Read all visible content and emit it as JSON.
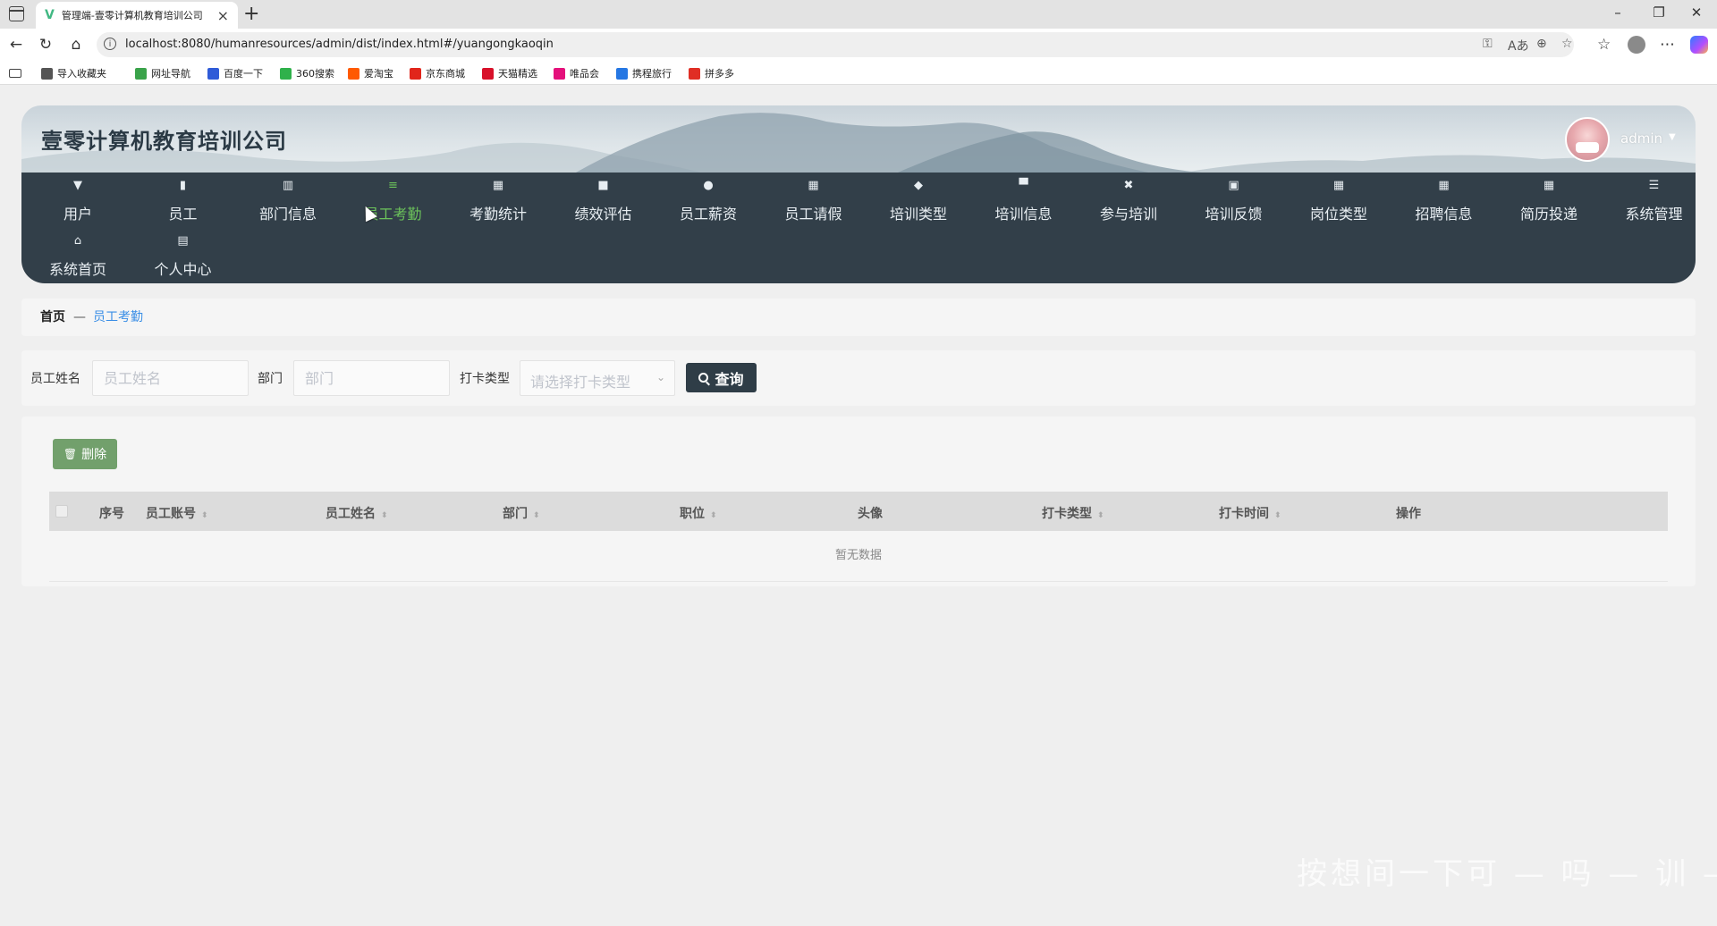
{
  "browser": {
    "tab_title": "管理端-壹零计算机教育培训公司",
    "url": "localhost:8080/humanresources/admin/dist/index.html#/yuangongkaoqin",
    "bookmarks": [
      {
        "label": "导入收藏夹",
        "icon": "import-icon",
        "color": "#555555"
      },
      {
        "label": "网址导航",
        "icon": "nav-leaf-icon",
        "color": "#3aa34a"
      },
      {
        "label": "百度一下",
        "icon": "baidu-paw-icon",
        "color": "#2f5bd8"
      },
      {
        "label": "360搜索",
        "icon": "360-ring-icon",
        "color": "#2fb14b"
      },
      {
        "label": "爱淘宝",
        "icon": "taobao-icon",
        "color": "#ff5a00"
      },
      {
        "label": "京东商城",
        "icon": "jd-icon",
        "color": "#e1251b"
      },
      {
        "label": "天猫精选",
        "icon": "tmall-icon",
        "color": "#d8112a"
      },
      {
        "label": "唯品会",
        "icon": "vip-icon",
        "color": "#e4107b"
      },
      {
        "label": "携程旅行",
        "icon": "ctrip-icon",
        "color": "#2577e3"
      },
      {
        "label": "拼多多",
        "icon": "pdd-icon",
        "color": "#e02e24"
      }
    ]
  },
  "header": {
    "site_title": "壹零计算机教育培训公司",
    "user_name": "admin"
  },
  "nav": {
    "active_index": 3,
    "items": [
      {
        "label": "用户",
        "icon": "▼"
      },
      {
        "label": "员工",
        "icon": "▮"
      },
      {
        "label": "部门信息",
        "icon": "▥"
      },
      {
        "label": "员工考勤",
        "icon": "≡"
      },
      {
        "label": "考勤统计",
        "icon": "▦"
      },
      {
        "label": "绩效评估",
        "icon": "■"
      },
      {
        "label": "员工薪资",
        "icon": "●"
      },
      {
        "label": "员工请假",
        "icon": "▦"
      },
      {
        "label": "培训类型",
        "icon": "◆"
      },
      {
        "label": "培训信息",
        "icon": "▀"
      },
      {
        "label": "参与培训",
        "icon": "✖"
      },
      {
        "label": "培训反馈",
        "icon": "▣"
      },
      {
        "label": "岗位类型",
        "icon": "▦"
      },
      {
        "label": "招聘信息",
        "icon": "▦"
      },
      {
        "label": "简历投递",
        "icon": "▦"
      },
      {
        "label": "系统管理",
        "icon": "☰"
      },
      {
        "label": "系统首页",
        "icon": "⌂"
      },
      {
        "label": "个人中心",
        "icon": "▤"
      }
    ]
  },
  "breadcrumb": {
    "home": "首页",
    "separator": "—",
    "current": "员工考勤"
  },
  "search": {
    "name_label": "员工姓名",
    "name_placeholder": "员工姓名",
    "dept_label": "部门",
    "dept_placeholder": "部门",
    "type_label": "打卡类型",
    "type_placeholder": "请选择打卡类型",
    "query_label": "查询"
  },
  "table": {
    "delete_label": "删除",
    "columns": [
      "序号",
      "员工账号",
      "员工姓名",
      "部门",
      "职位",
      "头像",
      "打卡类型",
      "打卡时间",
      "操作"
    ],
    "empty_text": "暂无数据"
  },
  "watermark": "按想间一下可 — 吗 — 训 — 训"
}
